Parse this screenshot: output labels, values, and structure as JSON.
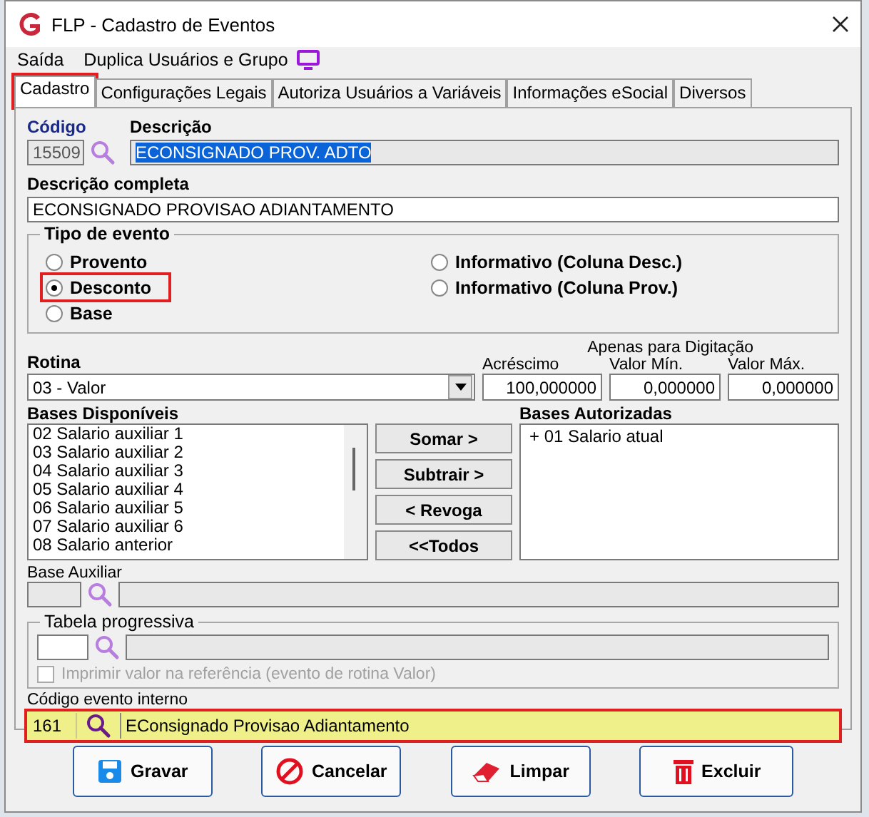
{
  "window": {
    "title": "FLP - Cadastro de Eventos"
  },
  "menu": [
    {
      "label": "Saída"
    },
    {
      "label": "Duplica Usuários e Grupo"
    }
  ],
  "tabs": [
    {
      "label": "Cadastro",
      "selected": true,
      "highlighted": true
    },
    {
      "label": "Configurações Legais",
      "selected": false,
      "highlighted": false
    },
    {
      "label": "Autoriza Usuários a Variáveis",
      "selected": false,
      "highlighted": false
    },
    {
      "label": "Informações eSocial",
      "selected": false,
      "highlighted": false
    },
    {
      "label": "Diversos",
      "selected": false,
      "highlighted": false
    }
  ],
  "codigo": {
    "label": "Código",
    "value": "15509"
  },
  "descricao": {
    "label": "Descrição",
    "value": "ECONSIGNADO PROV. ADTO",
    "text_selected": true
  },
  "descricao_completa": {
    "label": "Descrição completa",
    "value": "ECONSIGNADO PROVISAO ADIANTAMENTO"
  },
  "tipo_de_evento": {
    "title": "Tipo de evento",
    "options": [
      {
        "label": "Provento",
        "selected": false,
        "highlighted": false
      },
      {
        "label": "Desconto",
        "selected": true,
        "highlighted": true
      },
      {
        "label": "Base",
        "selected": false,
        "highlighted": false
      },
      {
        "label": "Informativo (Coluna Desc.)",
        "selected": false,
        "highlighted": false
      },
      {
        "label": "Informativo (Coluna Prov.)",
        "selected": false,
        "highlighted": false
      }
    ]
  },
  "rotina": {
    "label": "Rotina",
    "value": "03 - Valor"
  },
  "apenas_para_digitacao": "Apenas para Digitação",
  "amounts": [
    {
      "label": "Acréscimo",
      "value": "100,000000"
    },
    {
      "label": "Valor Mín.",
      "value": "0,000000"
    },
    {
      "label": "Valor Máx.",
      "value": "0,000000"
    }
  ],
  "bases_disponiveis": {
    "label": "Bases Disponíveis",
    "items": [
      "02 Salario auxiliar 1",
      "03 Salario auxiliar 2",
      "04 Salario auxiliar 3",
      "05 Salario auxiliar 4",
      "06 Salario auxiliar 5",
      "07 Salario auxiliar 6",
      "08 Salario anterior"
    ]
  },
  "transfer_buttons": [
    {
      "label": "Somar >"
    },
    {
      "label": "Subtrair >"
    },
    {
      "label": "< Revoga"
    },
    {
      "label": "<<Todos"
    }
  ],
  "bases_autorizadas": {
    "label": "Bases Autorizadas",
    "items": [
      "+ 01 Salario atual"
    ]
  },
  "base_auxiliar": {
    "label": "Base Auxiliar"
  },
  "tabela_progressiva": {
    "title": "Tabela progressiva",
    "checkbox": {
      "label": "Imprimir valor na referência (evento de rotina Valor)",
      "checked": false,
      "disabled": true
    }
  },
  "codigo_evento_interno": {
    "label": "Código evento interno",
    "code": "161",
    "description": "EConsignado Provisao Adiantamento",
    "highlighted": true
  },
  "actions": [
    {
      "label": "Gravar",
      "kind": "save"
    },
    {
      "label": "Cancelar",
      "kind": "cancel"
    },
    {
      "label": "Limpar",
      "kind": "clear"
    },
    {
      "label": "Excluir",
      "kind": "delete"
    }
  ]
}
